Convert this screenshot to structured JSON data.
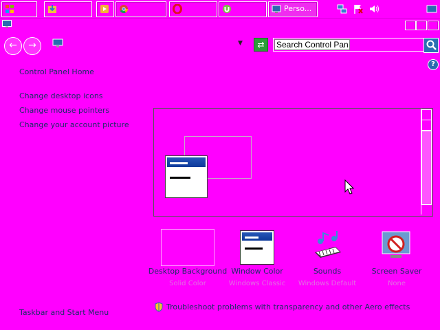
{
  "taskbar": {
    "buttons": [
      {
        "name": "start",
        "label": ""
      },
      {
        "name": "explorer",
        "label": ""
      },
      {
        "name": "media-player",
        "label": ""
      },
      {
        "name": "chrome",
        "label": ""
      },
      {
        "name": "opera",
        "label": ""
      },
      {
        "name": "utorrent",
        "label": ""
      },
      {
        "name": "personalization",
        "label": "Perso..."
      }
    ],
    "tray_icons": [
      "network-icon",
      "flag-icon",
      "volume-icon",
      "show-desktop-icon"
    ]
  },
  "address_bar": {
    "icon": "display-icon",
    "refresh_icon": "refresh-icon",
    "search_placeholder": "Search Control Panel"
  },
  "sidebar": {
    "home": "Control Panel Home",
    "links": [
      "Change desktop icons",
      "Change mouse pointers",
      "Change your account picture"
    ],
    "see_also": "Taskbar and Start Menu"
  },
  "themes": [
    {
      "label": "Desktop Background",
      "sub": "Solid Color"
    },
    {
      "label": "Window Color",
      "sub": "Windows Classic"
    },
    {
      "label": "Sounds",
      "sub": "Windows Default"
    },
    {
      "label": "Screen Saver",
      "sub": "None"
    }
  ],
  "aero_link": "Troubleshoot problems with transparency and other Aero effects",
  "colors": {
    "background": "#ff00ff",
    "link": "#1c2d66",
    "title_bar": "#2556b8"
  }
}
